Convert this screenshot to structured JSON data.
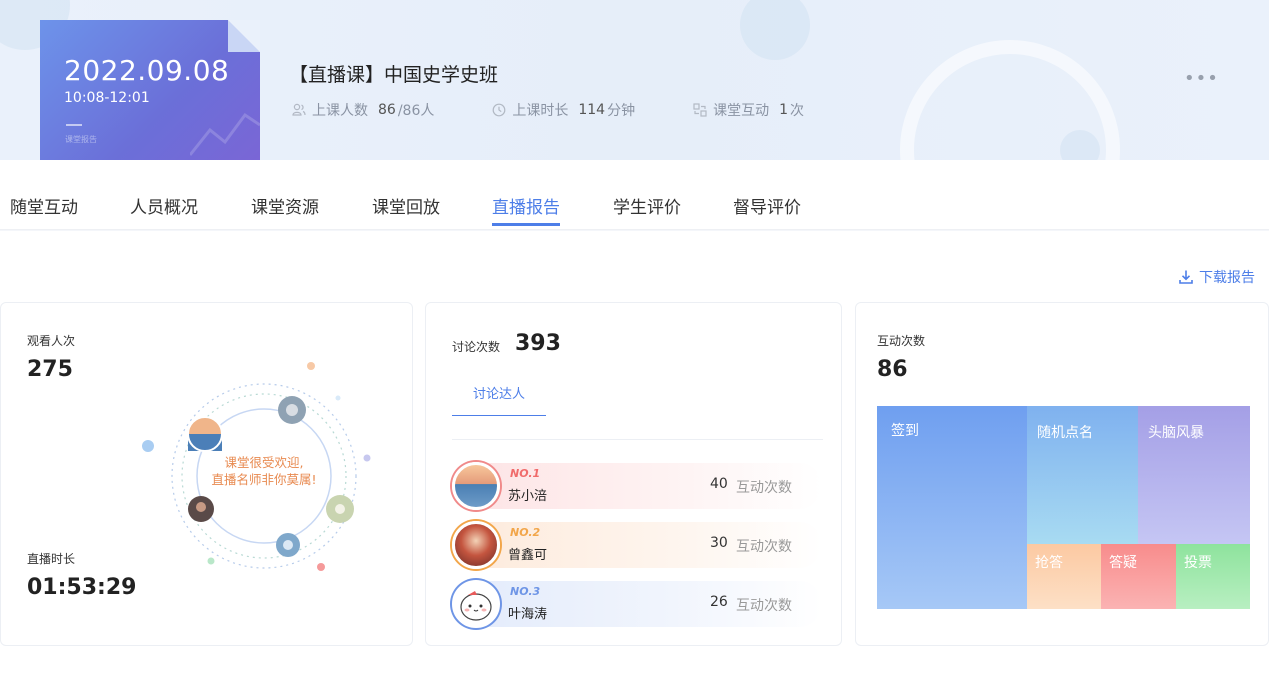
{
  "header": {
    "date": "2022.09.08",
    "time": "10:08-12:01",
    "card_label": "课堂报告",
    "course_title": "【直播课】中国史学史班",
    "stats": {
      "attend_label": "上课人数",
      "attend_value": "86",
      "attend_total": "/86人",
      "duration_label": "上课时长",
      "duration_value": "114",
      "duration_unit": "分钟",
      "interact_label": "课堂互动",
      "interact_value": "1",
      "interact_unit": "次"
    },
    "more_label": "•••"
  },
  "tabs": [
    {
      "label": "随堂互动"
    },
    {
      "label": "人员概况"
    },
    {
      "label": "课堂资源"
    },
    {
      "label": "课堂回放"
    },
    {
      "label": "直播报告",
      "active": true
    },
    {
      "label": "学生评价"
    },
    {
      "label": "督导评价"
    }
  ],
  "download_label": "下载报告",
  "watch": {
    "views_label": "观看人次",
    "views_value": "275",
    "duration_label": "直播时长",
    "duration_value": "01:53:29",
    "welcome_line1": "课堂很受欢迎,",
    "welcome_line2": "直播名师非你莫属!"
  },
  "discussion": {
    "count_label": "讨论次数",
    "count_value": "393",
    "subtab_label": "讨论达人",
    "ranks": [
      {
        "no": "NO.1",
        "name": "苏小涪",
        "count": "40",
        "count_label": "互动次数"
      },
      {
        "no": "NO.2",
        "name": "曾鑫可",
        "count": "30",
        "count_label": "互动次数"
      },
      {
        "no": "NO.3",
        "name": "叶海涛",
        "count": "26",
        "count_label": "互动次数"
      }
    ]
  },
  "interaction": {
    "count_label": "互动次数",
    "count_value": "86",
    "cells": [
      {
        "label": "签到"
      },
      {
        "label": "随机点名"
      },
      {
        "label": "头脑风暴"
      },
      {
        "label": "抢答"
      },
      {
        "label": "答疑"
      },
      {
        "label": "投票"
      }
    ]
  },
  "colors": {
    "accent": "#4d7ee8",
    "no1": "#f06b6b",
    "no2": "#f2a64a",
    "no3": "#6e95e6"
  }
}
